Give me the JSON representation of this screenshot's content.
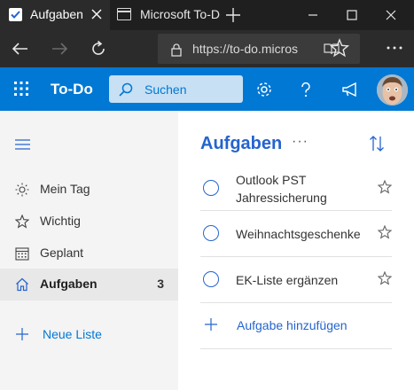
{
  "browser": {
    "tabs": [
      {
        "label": "Aufgaben",
        "active": true
      },
      {
        "label": "Microsoft To-D",
        "active": false
      }
    ],
    "address": {
      "url": "https://to-do.micros"
    }
  },
  "app": {
    "name": "To-Do",
    "search_placeholder": "Suchen",
    "accent": "#0078d4"
  },
  "sidebar": {
    "items": [
      {
        "label": "Mein Tag",
        "icon": "sun-icon",
        "count": ""
      },
      {
        "label": "Wichtig",
        "icon": "star-icon",
        "count": ""
      },
      {
        "label": "Geplant",
        "icon": "calendar-icon",
        "count": ""
      },
      {
        "label": "Aufgaben",
        "icon": "home-icon",
        "count": "3",
        "selected": true
      }
    ],
    "new_list_label": "Neue Liste"
  },
  "main": {
    "title": "Aufgaben",
    "more": "···",
    "tasks": [
      {
        "title": "Outlook PST Jahressicherung",
        "completed": false,
        "important": false
      },
      {
        "title": "Weihnachtsgeschenke",
        "completed": false,
        "important": false
      },
      {
        "title": "EK-Liste ergänzen",
        "completed": false,
        "important": false
      }
    ],
    "add_task_label": "Aufgabe hinzufügen"
  }
}
